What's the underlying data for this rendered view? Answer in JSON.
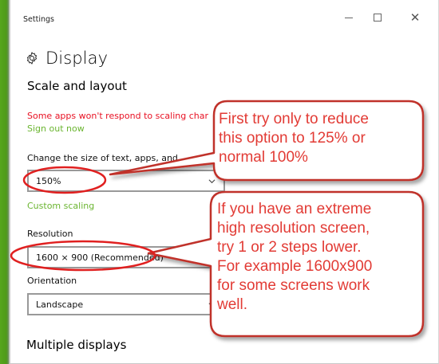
{
  "window": {
    "title": "Settings",
    "minimize_icon": "minimize-icon",
    "maximize_icon": "maximize-icon",
    "close_icon": "close-icon",
    "close_glyph": "✕"
  },
  "page": {
    "title": "Display",
    "title_icon": "gear-icon"
  },
  "scale_and_layout": {
    "heading": "Scale and layout",
    "warning": "Some apps won't respond to scaling char",
    "signout_link": "Sign out now",
    "size_label": "Change the size of text, apps, and",
    "scale_value": "150%",
    "custom_scaling_link": "Custom scaling",
    "resolution_label": "Resolution",
    "resolution_value": "1600 × 900 (Recommended)",
    "orientation_label": "Orientation",
    "orientation_value": "Landscape"
  },
  "multiple_displays": {
    "heading": "Multiple displays"
  },
  "annotations": {
    "callout1_lines": [
      "First try only to reduce",
      "this option to 125% or",
      "normal 100%"
    ],
    "callout2_lines": [
      "If you have an extreme",
      "high resolution screen,",
      "try 1 or 2 steps lower.",
      "For example 1600x900",
      "for some screens work",
      "well."
    ],
    "annotation_color": "#e23b35"
  },
  "colors": {
    "warning": "#e81123",
    "link": "#6bb531",
    "accent_edge": "#56a61c"
  }
}
